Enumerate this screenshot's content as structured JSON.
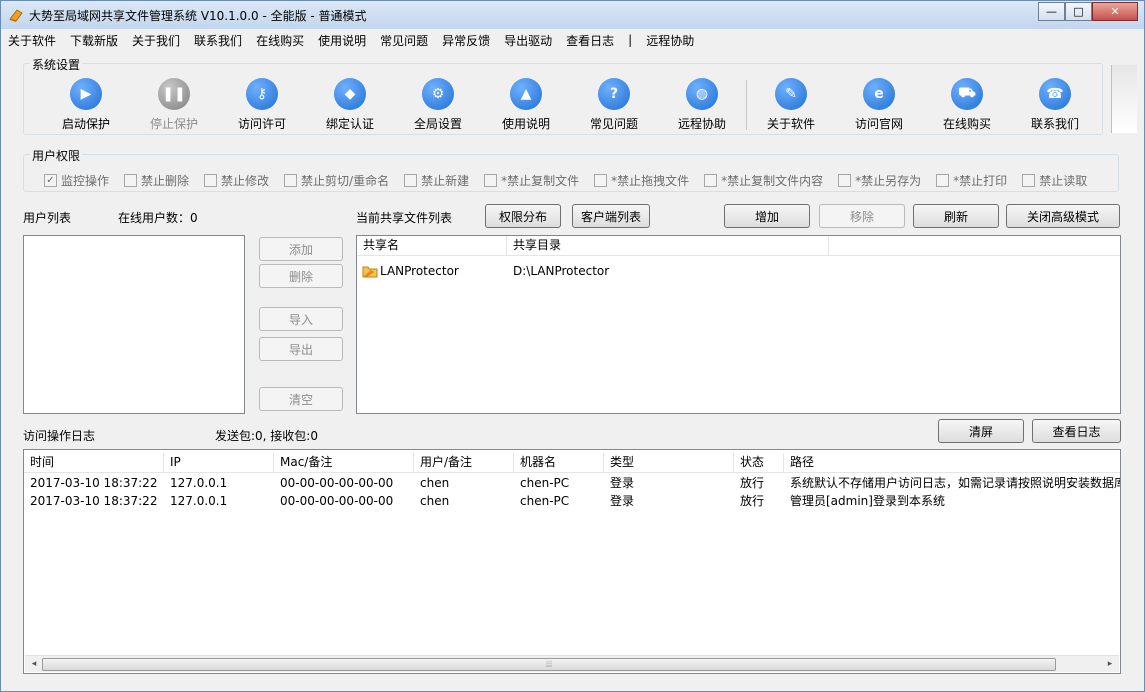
{
  "window": {
    "title": "大势至局域网共享文件管理系统 V10.1.0.0 - 全能版 - 普通模式",
    "minimize": "—",
    "restore": "□",
    "close": "✕"
  },
  "menu": [
    "关于软件",
    "下载新版",
    "关于我们",
    "联系我们",
    "在线购买",
    "使用说明",
    "常见问题",
    "异常反馈",
    "导出驱动",
    "查看日志",
    "|",
    "远程协助"
  ],
  "system_settings": {
    "title": "系统设置",
    "tools": [
      {
        "label": "启动保护",
        "icon": "play-icon",
        "glyph": "▶",
        "color": "#1f6fd1",
        "enabled": true
      },
      {
        "label": "停止保护",
        "icon": "pause-icon",
        "glyph": "❚❚",
        "color": "#7f7f7f",
        "enabled": false
      },
      {
        "label": "访问许可",
        "icon": "key-icon",
        "glyph": "⚷",
        "color": "#1f6fd1",
        "enabled": true
      },
      {
        "label": "绑定认证",
        "icon": "shield-icon",
        "glyph": "◆",
        "color": "#1f6fd1",
        "enabled": true
      },
      {
        "label": "全局设置",
        "icon": "gear-icon",
        "glyph": "⚙",
        "color": "#1f6fd1",
        "enabled": true
      },
      {
        "label": "使用说明",
        "icon": "graduation-cap-icon",
        "glyph": "▲",
        "color": "#1f6fd1",
        "enabled": true
      },
      {
        "label": "常见问题",
        "icon": "question-icon",
        "glyph": "?",
        "color": "#1f6fd1",
        "enabled": true
      },
      {
        "label": "远程协助",
        "icon": "globe-icon",
        "glyph": "◍",
        "color": "#1f6fd1",
        "enabled": true
      },
      {
        "label": "关于软件",
        "icon": "document-icon",
        "glyph": "✎",
        "color": "#1f6fd1",
        "enabled": true
      },
      {
        "label": "访问官网",
        "icon": "ie-browser-icon",
        "glyph": "e",
        "color": "#1f6fd1",
        "enabled": true
      },
      {
        "label": "在线购买",
        "icon": "cart-icon",
        "glyph": "⛟",
        "color": "#1f6fd1",
        "enabled": true
      },
      {
        "label": "联系我们",
        "icon": "phone-icon",
        "glyph": "☎",
        "color": "#1f6fd1",
        "enabled": true
      }
    ]
  },
  "permissions": {
    "title": "用户权限",
    "items": [
      {
        "label": "监控操作",
        "checked": true
      },
      {
        "label": "禁止删除",
        "checked": false
      },
      {
        "label": "禁止修改",
        "checked": false
      },
      {
        "label": "禁止剪切/重命名",
        "checked": false
      },
      {
        "label": "禁止新建",
        "checked": false
      },
      {
        "label": "*禁止复制文件",
        "checked": false
      },
      {
        "label": "*禁止拖拽文件",
        "checked": false
      },
      {
        "label": "*禁止复制文件内容",
        "checked": false
      },
      {
        "label": "*禁止另存为",
        "checked": false
      },
      {
        "label": "*禁止打印",
        "checked": false
      },
      {
        "label": "禁止读取",
        "checked": false
      }
    ]
  },
  "users": {
    "list_label": "用户列表",
    "online_label": "在线用户数：0",
    "buttons": {
      "add": "添加",
      "delete": "删除",
      "import": "导入",
      "export": "导出",
      "clear": "清空"
    }
  },
  "shares": {
    "list_label": "当前共享文件列表",
    "buttons": {
      "perm_dist": "权限分布",
      "client_list": "客户端列表",
      "add": "增加",
      "remove": "移除",
      "refresh": "刷新",
      "close_advanced": "关闭高级模式"
    },
    "columns": [
      "共享名",
      "共享目录"
    ],
    "rows": [
      {
        "name": "LANProtector",
        "path": "D:\\LANProtector"
      }
    ]
  },
  "log": {
    "label": "访问操作日志",
    "packets": "发送包:0, 接收包:0",
    "buttons": {
      "clear_screen": "清屏",
      "view_log": "查看日志"
    },
    "columns": [
      "时间",
      "IP",
      "Mac/备注",
      "用户/备注",
      "机器名",
      "类型",
      "状态",
      "路径"
    ],
    "rows": [
      [
        "2017-03-10 18:37:22",
        "127.0.0.1",
        "00-00-00-00-00-00",
        "chen",
        "chen-PC",
        "登录",
        "放行",
        "系统默认不存储用户访问日志，如需记录请按照说明安装数据库"
      ],
      [
        "2017-03-10 18:37:22",
        "127.0.0.1",
        "00-00-00-00-00-00",
        "chen",
        "chen-PC",
        "登录",
        "放行",
        "管理员[admin]登录到本系统"
      ]
    ],
    "scrollbar": {
      "left": "◂",
      "grip": "⦙⦙⦙",
      "right": "▸"
    }
  }
}
